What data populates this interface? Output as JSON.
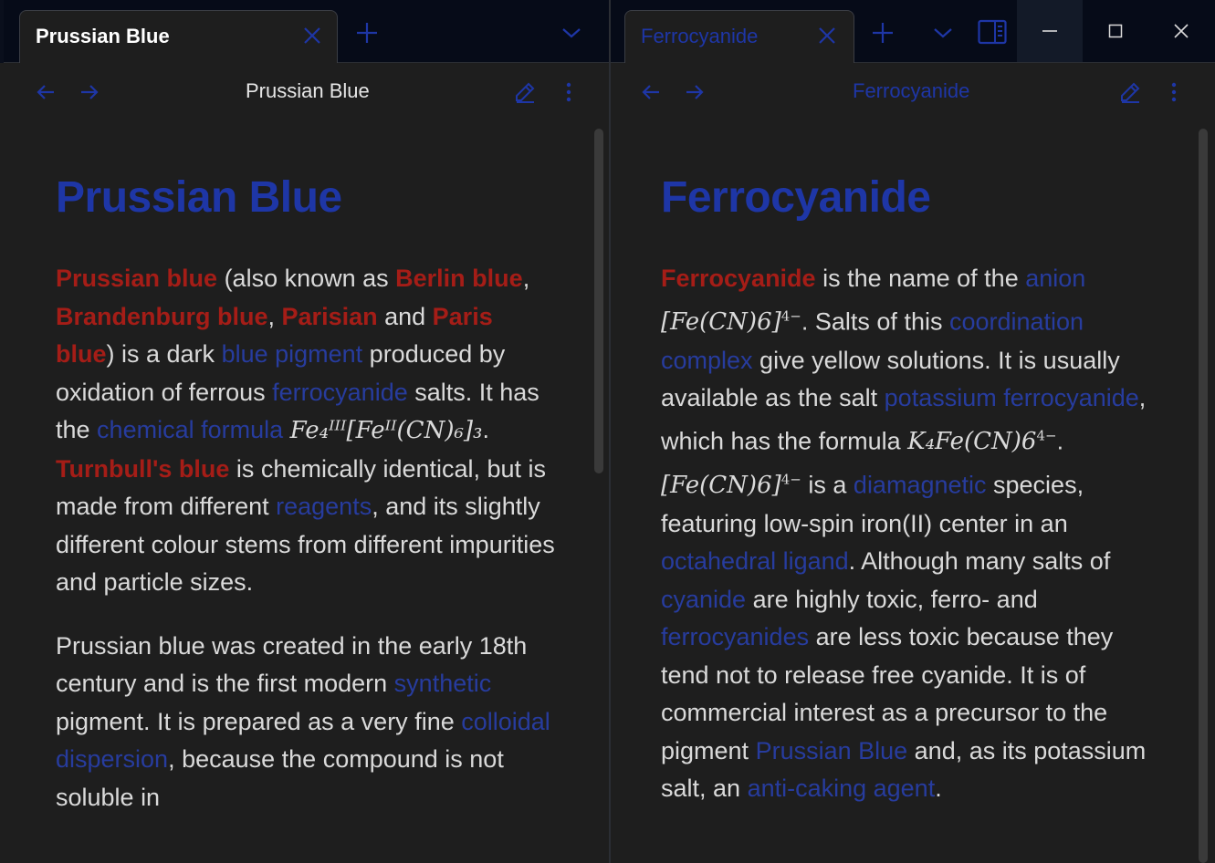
{
  "window": {
    "minimize_label": "minimize",
    "maximize_label": "maximize",
    "close_label": "close"
  },
  "left": {
    "tab_title": "Prussian Blue",
    "view_title": "Prussian Blue",
    "heading": "Prussian Blue",
    "p1": {
      "t1": "Prussian blue",
      "t2": " (also known as ",
      "t3": "Berlin blue",
      "t4": ", ",
      "t5": "Brandenburg blue",
      "t6": ", ",
      "t7": "Parisian",
      "t8": " and ",
      "t9": "Paris blue",
      "t10": ") is a dark ",
      "t11": "blue pigment",
      "t12": " produced by oxidation of ferrous ",
      "t13": "ferrocyanide",
      "t14": " salts. It has the ",
      "t15": "chemical formula",
      "formula": "Fe₄ᴵᴵᴵ[Feᴵᴵ(CN)₆]₃",
      "t16": ". ",
      "t17": "Turnbull's blue",
      "t18": " is chemically identical, but is made from different ",
      "t19": "reagents",
      "t20": ", and its slightly different colour stems from different impurities and particle sizes."
    },
    "p2": {
      "t1": "Prussian blue was created in the early 18th century and is the first modern ",
      "t2": "synthetic",
      "t3": " pigment. It is prepared as a very fine ",
      "t4": "colloidal dispersion",
      "t5": ", because the compound is not soluble in"
    }
  },
  "right": {
    "tab_title": "Ferrocyanide",
    "view_title": "Ferrocyanide",
    "heading": "Ferrocyanide",
    "p1": {
      "t1": "Ferrocyanide",
      "t2": " is the name of the ",
      "t3": "anion",
      "f1": "[Fe(CN)6]",
      "f1sup": "4−",
      "t4": ". Salts of this ",
      "t5": "coordination complex",
      "t6": " give yellow solutions. It is usually available as the salt ",
      "t7": "potassium ferrocyanide",
      "t8": ", which has the formula ",
      "f2": "K₄Fe(CN)6",
      "f2sup": "4−",
      "t9": ". ",
      "f3": "[Fe(CN)6]",
      "f3sup": "4−",
      "t10": " is a ",
      "t11": "diamagnetic",
      "t12": " species, featuring low-spin iron(II) center in an ",
      "t13": "octahedral ligand",
      "t14": ". Although many salts of ",
      "t15": "cyanide",
      "t16": " are highly toxic, ferro- and ",
      "t17": "ferrocyanides",
      "t18": " are less toxic because they tend not to release free cyanide. It is of commercial interest as a precursor to the pigment ",
      "t19": "Prussian Blue",
      "t20": " and, as its potassium salt, an ",
      "t21": "anti-caking agent",
      "t22": "."
    }
  },
  "colors": {
    "accent": "#1e36a6",
    "bold_link": "#a51d17",
    "link": "#273c9e",
    "tabbar": "#060b18",
    "background": "#1e1e1e"
  }
}
